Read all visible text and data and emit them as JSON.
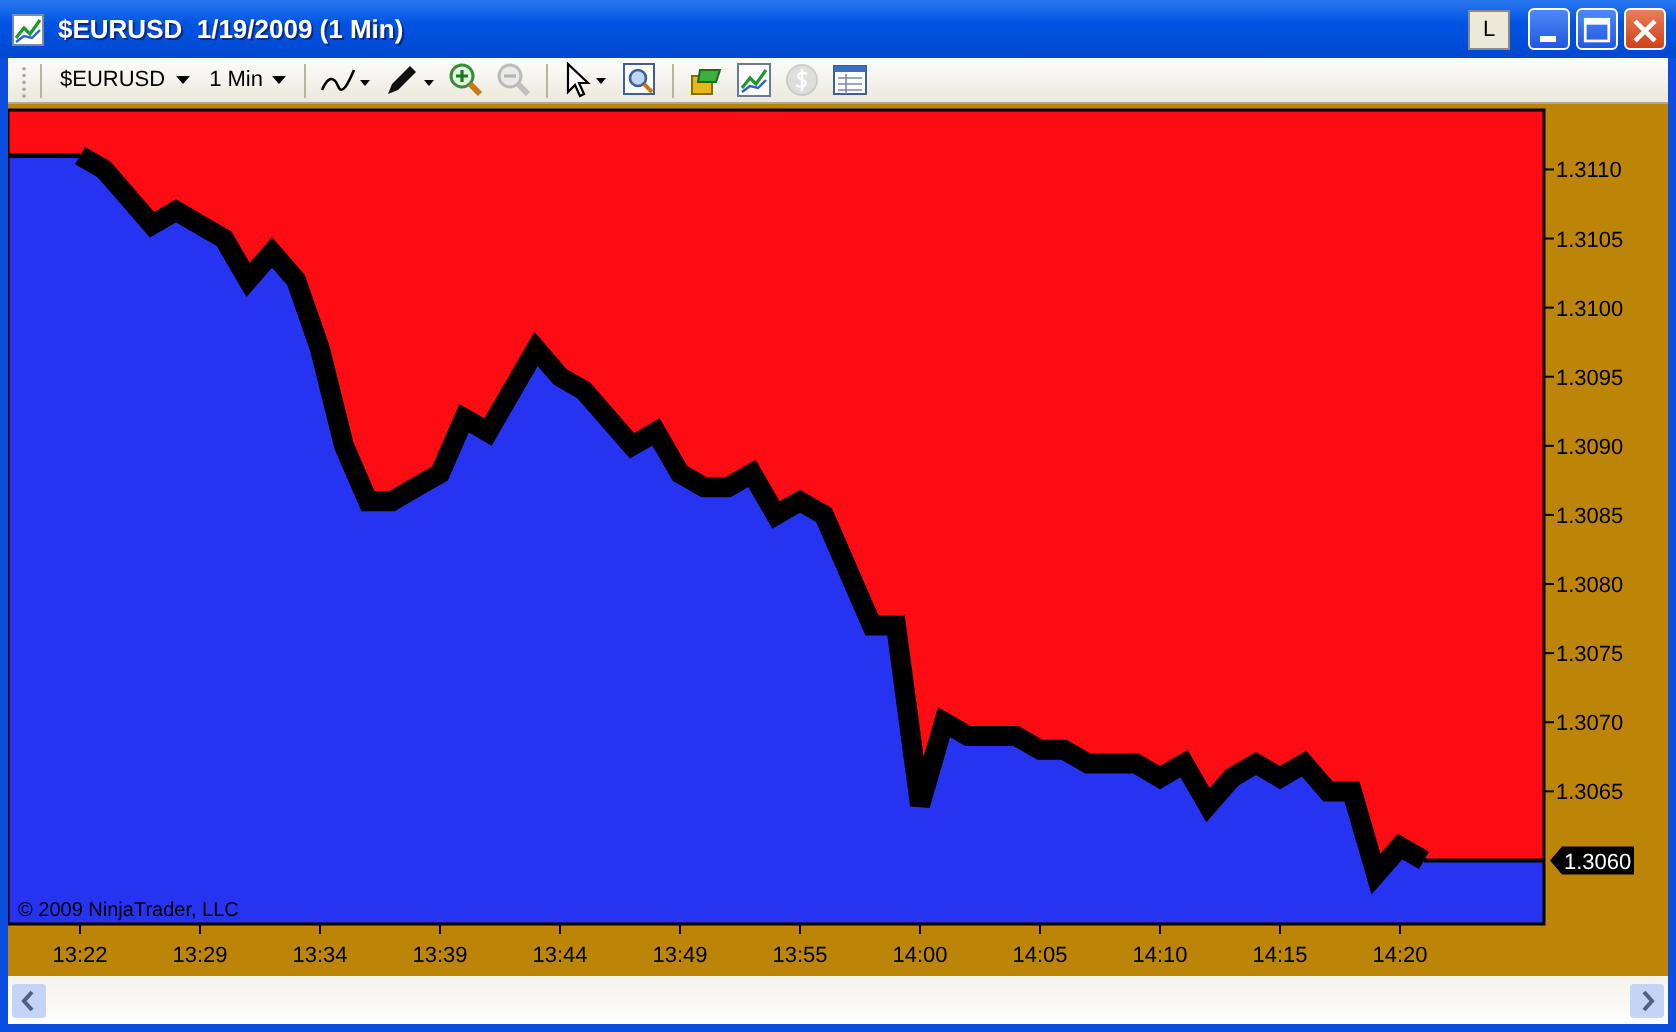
{
  "window": {
    "title": "$EURUSD  1/19/2009 (1 Min)",
    "extra_button": "L"
  },
  "toolbar": {
    "instrument": "$EURUSD",
    "interval": "1 Min",
    "tools": [
      {
        "kind": "linetype",
        "disabled": false
      },
      {
        "kind": "pencil",
        "disabled": false
      },
      {
        "kind": "zoomin",
        "disabled": false
      },
      {
        "kind": "zoomout",
        "disabled": true
      },
      {
        "kind": "pointer",
        "disabled": false
      },
      {
        "kind": "zoombox",
        "disabled": false
      },
      {
        "kind": "strategy",
        "disabled": false
      },
      {
        "kind": "chart",
        "disabled": false
      },
      {
        "kind": "coin",
        "disabled": true
      },
      {
        "kind": "table",
        "disabled": false
      }
    ]
  },
  "chart": {
    "copyright": "© 2009 NinjaTrader, LLC",
    "price_marker": "1.3060",
    "chart_data": {
      "type": "area",
      "categories": [
        null,
        null,
        null,
        "13:22",
        null,
        null,
        null,
        null,
        "13:29",
        null,
        null,
        null,
        null,
        "13:34",
        null,
        null,
        null,
        null,
        "13:39",
        null,
        null,
        null,
        null,
        "13:44",
        null,
        null,
        null,
        null,
        "13:49",
        null,
        null,
        null,
        null,
        "13:55",
        null,
        null,
        null,
        null,
        "14:00",
        null,
        null,
        null,
        null,
        "14:05",
        null,
        null,
        null,
        null,
        "14:10",
        null,
        null,
        null,
        null,
        "14:15",
        null,
        null,
        null,
        null,
        "14:20",
        null
      ],
      "series": [
        {
          "color": "#2633f0",
          "values": [
            1.3111,
            1.3111,
            1.3111,
            1.3111,
            1.311,
            1.3108,
            1.3106,
            1.3107,
            1.3106,
            1.3105,
            1.3102,
            1.3104,
            1.3102,
            1.3097,
            1.309,
            1.3086,
            1.3086,
            1.3087,
            1.3088,
            1.3092,
            1.3091,
            1.3094,
            1.3097,
            1.3095,
            1.3094,
            1.3092,
            1.309,
            1.3091,
            1.3088,
            1.3087,
            1.3087,
            1.3088,
            1.3085,
            1.3086,
            1.3085,
            1.3081,
            1.3077,
            1.3077,
            1.3064,
            1.307,
            1.3069,
            1.3069,
            1.3069,
            1.3068,
            1.3068,
            1.3067,
            1.3067,
            1.3067,
            1.3066,
            1.3067,
            1.3064,
            1.3066,
            1.3067,
            1.3066,
            1.3067,
            1.3065,
            1.3065,
            1.3059,
            1.3061,
            1.306
          ]
        }
      ],
      "ylim": [
        1.30554,
        1.31143
      ],
      "yticks": [
        {
          "value": 1.3065,
          "label": "1.3065"
        },
        {
          "value": 1.307,
          "label": "1.3070"
        },
        {
          "value": 1.3075,
          "label": "1.3075"
        },
        {
          "value": 1.308,
          "label": "1.3080"
        },
        {
          "value": 1.3085,
          "label": "1.3085"
        },
        {
          "value": 1.309,
          "label": "1.3090"
        },
        {
          "value": 1.3095,
          "label": "1.3095"
        },
        {
          "value": 1.31,
          "label": "1.3100"
        },
        {
          "value": 1.3105,
          "label": "1.3105"
        },
        {
          "value": 1.311,
          "label": "1.3110"
        }
      ]
    }
  }
}
